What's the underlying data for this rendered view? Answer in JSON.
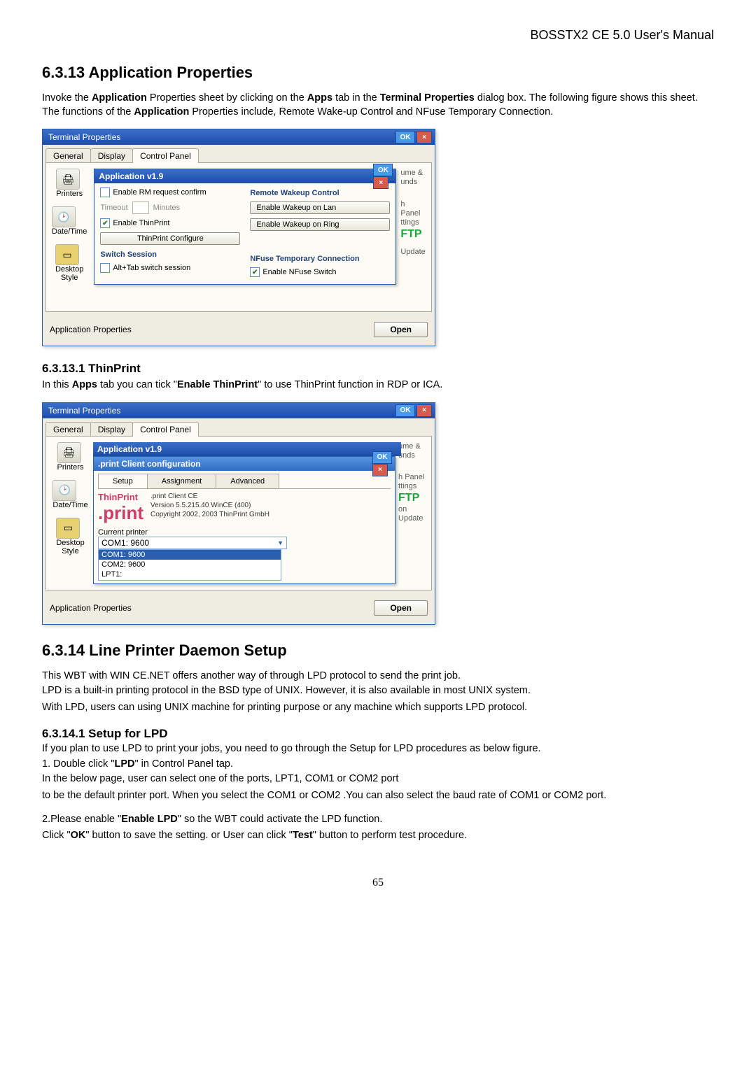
{
  "header": {
    "manual_title": "BOSSTX2 CE 5.0 User's Manual"
  },
  "sec_6_3_13": {
    "heading": "6.3.13 Application Properties",
    "intro_pre": "Invoke the ",
    "intro_b1": "Application",
    "intro_mid1": " Properties sheet by clicking on the ",
    "intro_b2": "Apps",
    "intro_mid2": " tab in the ",
    "intro_b3": "Terminal Properties",
    "intro_mid3": " dialog box. The following figure shows this sheet. The functions of the ",
    "intro_b4": "Application",
    "intro_end": " Properties include, Remote Wake-up Control and NFuse Temporary Connection."
  },
  "dialog1": {
    "titlebar": "Terminal Properties",
    "ok": "OK",
    "close": "×",
    "tabs": {
      "general": "General",
      "display": "Display",
      "control_panel": "Control Panel"
    },
    "side_icons": {
      "printers": "Printers",
      "datetime": "Date/Time",
      "desktop_style": "Desktop\nStyle"
    },
    "app_popup": {
      "title": "Application v1.9",
      "enable_rm": "Enable RM request confirm",
      "timeout": "Timeout",
      "minutes": "Minutes",
      "enable_thinprint": "Enable ThinPrint",
      "thinprint_configure": "ThinPrint Configure",
      "switch_session_h": "Switch Session",
      "alt_tab": "Alt+Tab switch session",
      "remote_wakeup_h": "Remote Wakeup Control",
      "wakeup_lan": "Enable Wakeup on Lan",
      "wakeup_ring": "Enable Wakeup on Ring",
      "nfuse_h": "NFuse Temporary Connection",
      "nfuse_switch": "Enable NFuse Switch"
    },
    "right_frags": {
      "line1": "ume &",
      "line2": "unds",
      "line3": "h Panel",
      "line4": "ttings",
      "ftp": "FTP",
      "update": "Update"
    },
    "footer_label": "Application Properties",
    "open": "Open"
  },
  "sec_6_3_13_1": {
    "heading": "6.3.13.1 ThinPrint",
    "line_pre": "In this ",
    "line_b1": "Apps",
    "line_mid1": " tab you can tick \"",
    "line_b2": "Enable ThinPrint",
    "line_end": "\" to use ThinPrint function in RDP or ICA."
  },
  "dialog2": {
    "titlebar": "Terminal Properties",
    "ok": "OK",
    "close": "×",
    "tabs": {
      "general": "General",
      "display": "Display",
      "control_panel": "Control Panel"
    },
    "side_icons": {
      "printers": "Printers",
      "datetime": "Date/Time",
      "desktop_style": "Desktop\nStyle"
    },
    "app_popup_title": "Application v1.9",
    "tp_popup": {
      "title": ".print Client configuration",
      "subtabs": {
        "setup": "Setup",
        "assignment": "Assignment",
        "advanced": "Advanced"
      },
      "logo_small": "ThinPrint",
      "logo_big": ".print",
      "ver_line1": ".print Client CE",
      "ver_line2": "Version  5.5.215.40 WinCE (400)",
      "ver_line3": "Copyright 2002, 2003 ThinPrint GmbH",
      "current_printer": "Current printer",
      "dd_selected": "COM1: 9600",
      "dd_items": {
        "i0": "COM1: 9600",
        "i1": "COM2: 9600",
        "i2": "LPT1:"
      }
    },
    "right_frags": {
      "line1": "ume &",
      "line2": "unds",
      "line3": "h Panel",
      "line4": "ttings",
      "ftp": "FTP",
      "on": "on",
      "update": "Update"
    },
    "footer_label": "Application Properties",
    "open": "Open"
  },
  "sec_6_3_14": {
    "heading": "6.3.14 Line Printer Daemon Setup",
    "p1": "This WBT with WIN CE.NET offers another way of through LPD protocol to send the print job.",
    "p2": "LPD is a built-in printing protocol in the BSD type of UNIX. However, it is also available in most UNIX system.",
    "p3": "With LPD, users can using UNIX machine for printing purpose or any machine which supports LPD protocol."
  },
  "sec_6_3_14_1": {
    "heading": "6.3.14.1 Setup for LPD",
    "p1": "If you plan to use LPD to print your jobs, you need to go through the Setup for LPD procedures as below figure.",
    "p2_pre": "1. Double click \"",
    "p2_b": "LPD",
    "p2_end": "\" in Control Panel tap.",
    "p3": "In the below page, user can select one of the ports, LPT1, COM1 or COM2 port",
    "p4": "to be the default printer port. When you select the COM1 or COM2 .You can also select the baud rate of COM1 or COM2 port.",
    "p5_pre": "2.Please enable \"",
    "p5_b": "Enable LPD",
    "p5_end": "\" so the WBT could activate the LPD function.",
    "p6_pre": "Click \"",
    "p6_b1": "OK",
    "p6_mid": "\" button to save the setting. or User can click \"",
    "p6_b2": "Test",
    "p6_end": "\" button to perform test procedure."
  },
  "page_number": "65"
}
